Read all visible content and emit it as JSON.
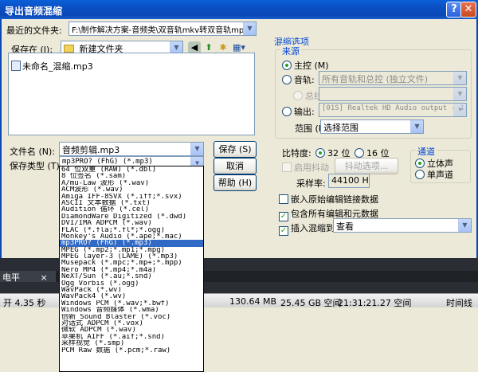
{
  "window": {
    "title": "导出音频混缩",
    "help_glyph": "?",
    "close_glyph": "✕"
  },
  "recent": {
    "label": "最近的文件夹:",
    "value": "F:\\制作解决方案-音频类\\双音轨mkv转双音轨mpg\\新建文件夹"
  },
  "save_in": {
    "label": "保存在 (I):",
    "value": "新建文件夹"
  },
  "file_list": {
    "items": [
      "未命名_混缩.mp3"
    ]
  },
  "filename": {
    "label": "文件名 (N):",
    "value": "音频剪辑.mp3"
  },
  "filetype": {
    "label": "保存类型 (T):",
    "value": "mp3PRO? (FhG) (*.mp3)"
  },
  "buttons": {
    "save": "保存 (S)",
    "cancel": "取消",
    "help": "帮助 (H)"
  },
  "mix_options": {
    "title": "混缩选项",
    "source_title": "来源",
    "master": "主控 (M)",
    "track": "音轨:",
    "track_value": "所有音轨和总控 (独立文件)",
    "bus": "总线:",
    "output": "输出:",
    "output_value": "[01S] Realtek HD Audio output - 1",
    "range_label": "范围 (R)",
    "range_value": "选择范围"
  },
  "bitdepth": {
    "label": "比特度:",
    "opt32": "32 位",
    "opt16": "16 位",
    "dither": "启用抖动",
    "dither_btn": "抖动选项...",
    "samplerate_label": "采样率:",
    "samplerate_value": "44100 Hz"
  },
  "channel": {
    "title": "通道",
    "stereo": "立体声",
    "mono": "单声道"
  },
  "checks": {
    "embed": "嵌入原始编辑链接数据",
    "include_markers": "包含所有编辑和元数据",
    "insert_label": "插入混缩到:",
    "insert_value": "查看"
  },
  "bg_app": {
    "tab_label": "电平",
    "tab_close": "×",
    "status": {
      "time": "开 4.35 秒",
      "mem": "130.64 MB",
      "disk": "25.45 GB 空间",
      "time2": "21:31:21.27 空间",
      "view": "时间线"
    }
  },
  "type_options": [
    "64 位双重 (RAW) (*.dbl)",
    "8 位签名 (*.sam)",
    "A/mu-Law 波形 (*.wav)",
    "ACM波形 (*.wav)",
    "Amiga IFF-8SVX (*.iff;*.svx)",
    "ASCII 文本数据 (*.txt)",
    "Audition 循环 (*.cel)",
    "DiamondWare Digitized (*.dwd)",
    "DVI/IMA ADPCM (*.wav)",
    "FLAC (*.fla;*.fl*;*.ogg)",
    "Monkey's Audio (*.ape;*.mac)",
    "mp3PRO? (FhG) (*.mp3)",
    "MPEG (*.mp2;*.mp1;*.mpg)",
    "MPEG layer-3 (LAME) (*.mp3)",
    "Musepack (*.mpc;*.mp+;*.mpp)",
    "Nero MP4 (*.mp4;*.m4a)",
    "NeXT/Sun (*.au;*.snd)",
    "Ogg Vorbis (*.ogg)",
    "WavPack (*.wv)",
    "WavPack4 (*.wv)",
    "Windows PCM (*.wav;*.bwf)",
    "Windows 音频媒体 (*.wma)",
    "创新 Sound Blaster (*.voc)",
    "对话式 ADPCM (*.vox)",
    "微软 ADPCM (*.wav)",
    "苹果机 AIFF (*.aif;*.snd)",
    "采样视觉 (*.smp)",
    "PCM Raw 数据 (*.pcm;*.raw)"
  ],
  "selected_type_index": 11
}
